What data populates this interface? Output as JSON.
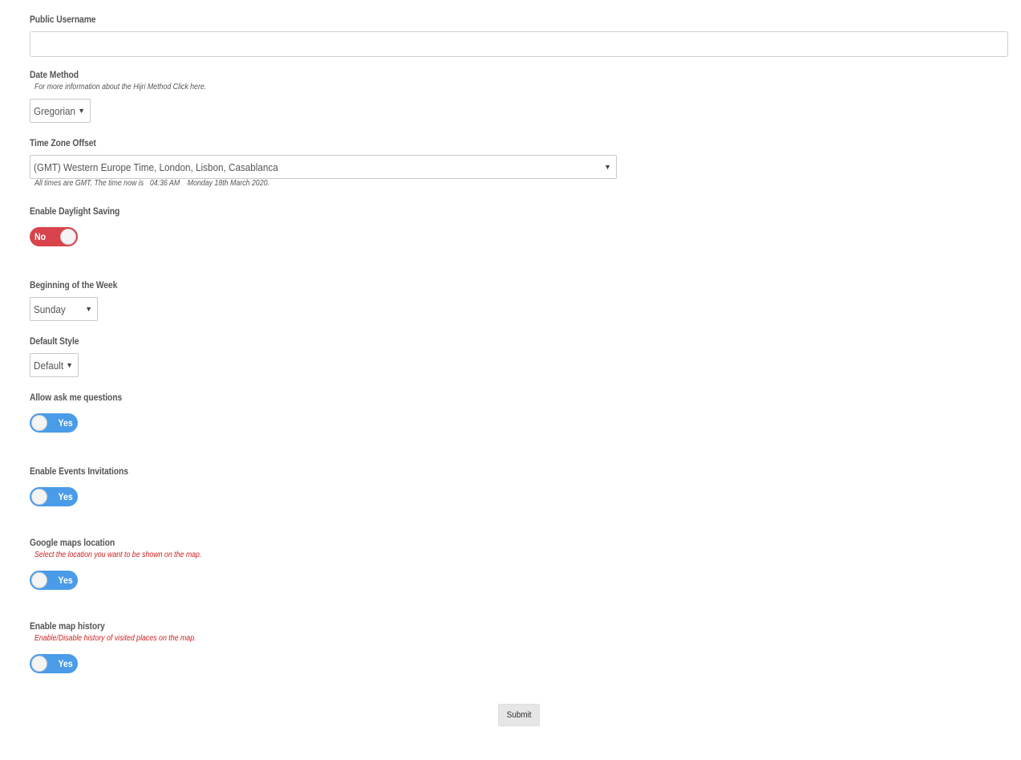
{
  "public_username": {
    "label": "Public Username",
    "value": "",
    "placeholder": ""
  },
  "date_method": {
    "label": "Date Method",
    "hint": "For more information about the Hijri Method Click here.",
    "selected": "Gregorian"
  },
  "time_zone": {
    "label": "Time Zone Offset",
    "selected": "(GMT) Western Europe Time, London, Lisbon, Casablanca",
    "hint_prefix": "All times are GMT. The time now is",
    "time_now": "04:36 AM",
    "date_now": "Monday 18th March 2020."
  },
  "daylight_saving": {
    "label": "Enable Daylight Saving",
    "state": "No"
  },
  "week_start": {
    "label": "Beginning of the Week",
    "selected": "Sunday"
  },
  "default_style": {
    "label": "Default Style",
    "selected": "Default"
  },
  "ask_questions": {
    "label": "Allow ask me questions",
    "state": "Yes"
  },
  "events_invitations": {
    "label": "Enable Events Invitations",
    "state": "Yes"
  },
  "maps_location": {
    "label": "Google maps location",
    "hint": "Select the location you want to be shown on the map.",
    "state": "Yes"
  },
  "map_history": {
    "label": "Enable map history",
    "hint": "Enable/Disable history of visited places on the map.",
    "state": "Yes"
  },
  "submit_label": "Submit",
  "colors": {
    "toggle_on": "#4a9ce8",
    "toggle_off": "#d9434b",
    "hint_red": "#cc1f1f"
  }
}
